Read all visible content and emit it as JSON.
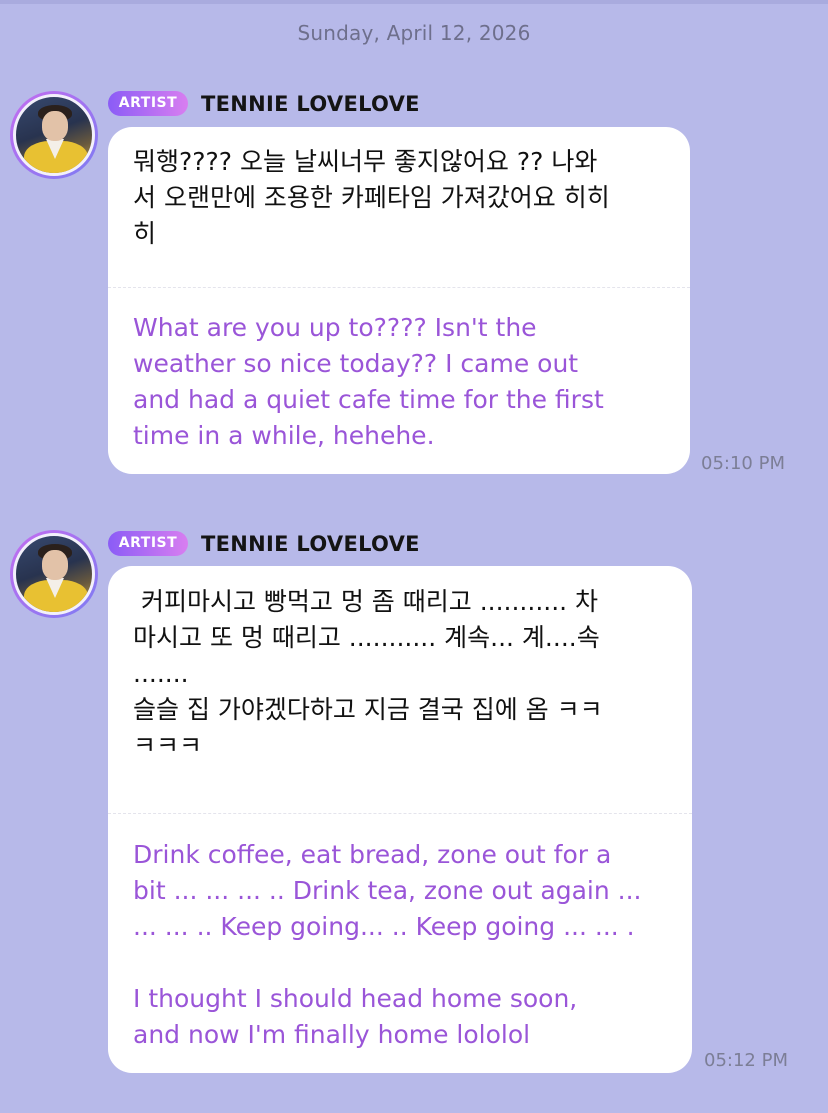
{
  "date_header": "Sunday, April 12, 2026",
  "messages": [
    {
      "badge": "ARTIST",
      "sender": "TENNIE LOVELOVE",
      "original": "뭐행???? 오늘 날씨너무 좋지않어요 ?? 나와\n서 오랜만에 조용한 카페타임 가져갔어요 히히\n히",
      "translation": "What are you up to???? Isn't the\nweather so nice today?? I came out\nand had a quiet cafe time for the first\ntime in a while, hehehe.",
      "time": "05:10 PM"
    },
    {
      "badge": "ARTIST",
      "sender": "TENNIE LOVELOVE",
      "original": " 커피마시고 빵먹고 멍 좀 때리고 ........... 차\n마시고 또 멍 때리고 ........... 계속... 계....속\n.......\n슬슬 집 가야겠다하고 지금 결국 집에 옴 ㅋㅋ\nㅋㅋㅋ",
      "translation": "Drink coffee, eat bread, zone out for a\nbit ... ... ... .. Drink tea, zone out again ...\n... ... .. Keep going... .. Keep going ... ... .\n\nI thought I should head home soon,\nand now I'm finally home lololol",
      "time": "05:12 PM"
    }
  ]
}
